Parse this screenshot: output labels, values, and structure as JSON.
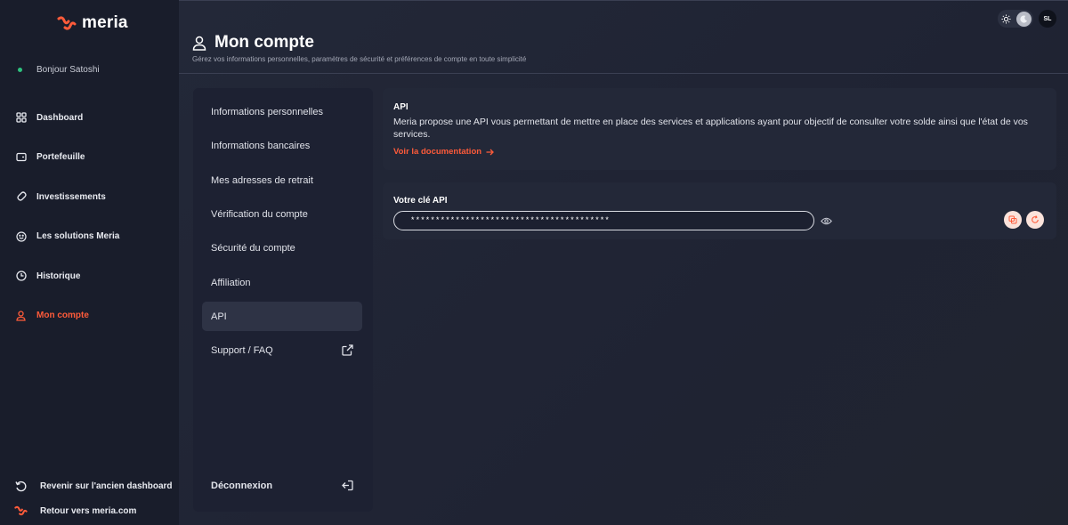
{
  "sidebar": {
    "logo_text": "meria",
    "greeting": "Bonjour Satoshi",
    "items": [
      {
        "label": "Dashboard",
        "icon": "grid-icon"
      },
      {
        "label": "Portefeuille",
        "icon": "wallet-icon"
      },
      {
        "label": "Investissements",
        "icon": "investments-icon"
      },
      {
        "label": "Les solutions Meria",
        "icon": "smile-icon"
      },
      {
        "label": "Historique",
        "icon": "clock-icon"
      },
      {
        "label": "Mon compte",
        "icon": "user-icon",
        "active": true
      }
    ],
    "bottom": {
      "old_dashboard": "Revenir sur l'ancien dashboard",
      "back_site": "Retour vers meria.com"
    }
  },
  "header": {
    "title": "Mon compte",
    "subtitle": "Gérez vos informations personnelles, paramètres de sécurité et préférences de compte en toute simplicité",
    "avatar_initials": "SL"
  },
  "account_menu": {
    "items": [
      {
        "label": "Informations personnelles"
      },
      {
        "label": "Informations bancaires"
      },
      {
        "label": "Mes adresses de retrait"
      },
      {
        "label": "Vérification du compte"
      },
      {
        "label": "Sécurité du compte"
      },
      {
        "label": "Affiliation"
      },
      {
        "label": "API",
        "active": true
      },
      {
        "label": "Support / FAQ",
        "external": true
      }
    ],
    "logout": "Déconnexion"
  },
  "api": {
    "title": "API",
    "description": "Meria propose une API vous permettant de mettre en place des services et applications ayant pour objectif de consulter votre solde ainsi que l'état de vos services.",
    "doc_link": "Voir la documentation",
    "key_label": "Votre clé API",
    "key_value": "****************************************"
  },
  "colors": {
    "accent": "#ff5b3a",
    "online": "#2ec27e",
    "sidebar_bg": "#191d2b",
    "main_bg": "#1f2333"
  }
}
